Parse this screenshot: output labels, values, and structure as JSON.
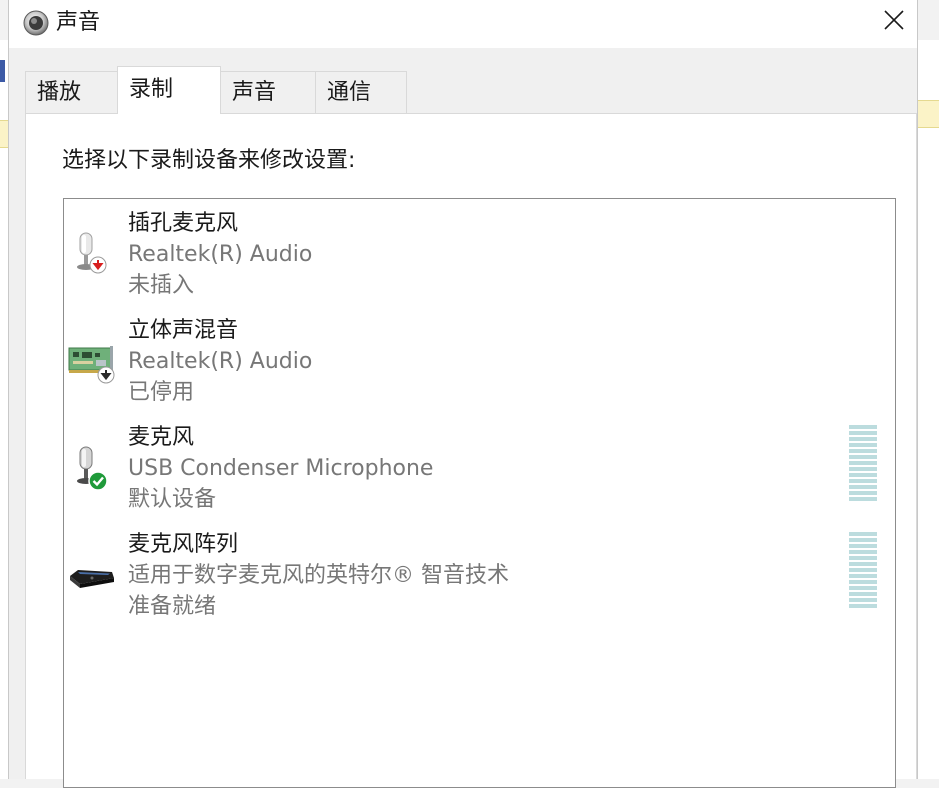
{
  "window": {
    "title": "声音",
    "title_icon": "speaker-icon",
    "close_icon": "close-icon"
  },
  "tabs": [
    {
      "label": "播放",
      "active": false
    },
    {
      "label": "录制",
      "active": true
    },
    {
      "label": "声音",
      "active": false
    },
    {
      "label": "通信",
      "active": false
    }
  ],
  "recording": {
    "instruction": "选择以下录制设备来修改设置:",
    "devices": [
      {
        "name": "插孔麦克风",
        "driver": "Realtek(R) Audio",
        "status": "未插入",
        "icon": "microphone-icon",
        "badge": "unplugged-badge",
        "level": 0
      },
      {
        "name": "立体声混音",
        "driver": "Realtek(R) Audio",
        "status": "已停用",
        "icon": "sound-card-icon",
        "badge": "disabled-badge",
        "level": 0
      },
      {
        "name": "麦克风",
        "driver": "USB Condenser Microphone",
        "status": "默认设备",
        "icon": "microphone-icon",
        "badge": "default-check-badge",
        "level": 0
      },
      {
        "name": "麦克风阵列",
        "driver": "适用于数字麦克风的英特尔® 智音技术",
        "status": "准备就绪",
        "icon": "mic-array-icon",
        "badge": "",
        "level": 0
      }
    ]
  },
  "colors": {
    "meter_segment": "#bcdcde",
    "secondary_text": "#777777",
    "default_badge": "#1f9a3a",
    "unplugged_badge": "#d81e1e"
  }
}
